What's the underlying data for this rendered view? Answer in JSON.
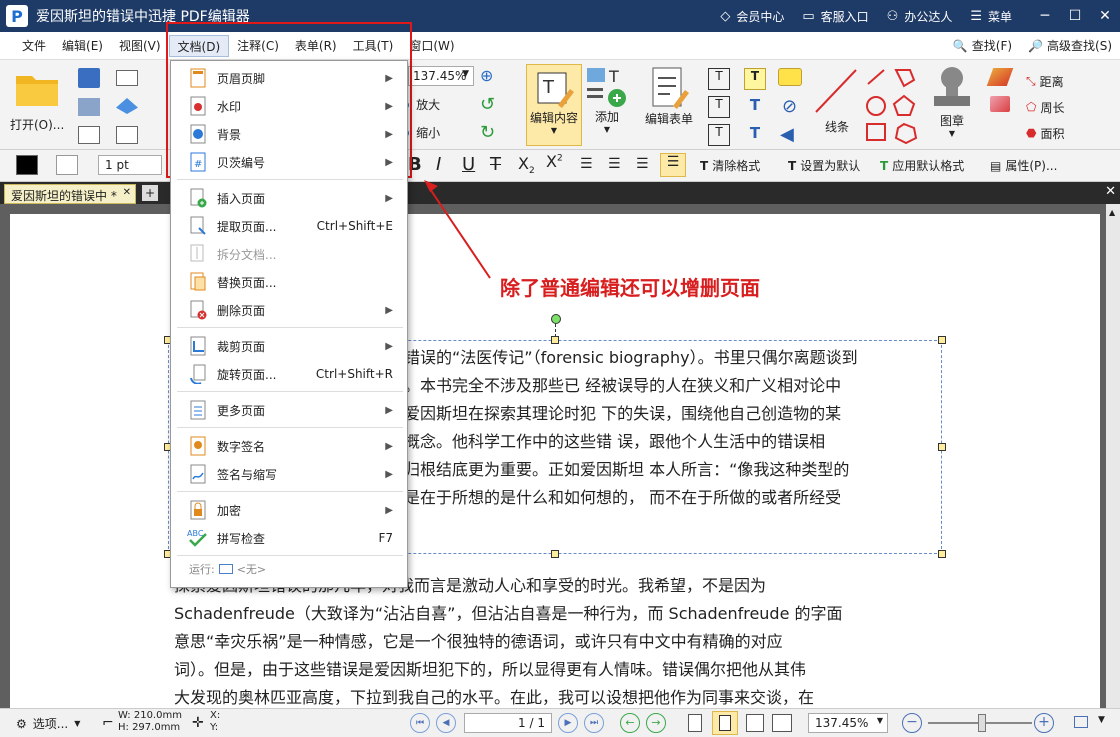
{
  "window": {
    "title": "爱因斯坦的错误中迅捷 PDF编辑器",
    "logo": "P",
    "member": "会员中心",
    "service": "客服入口",
    "user": "办公达人",
    "menu": "菜单"
  },
  "menubar": {
    "items": [
      "文件",
      "编辑(E)",
      "视图(V)",
      "文档(D)",
      "注释(C)",
      "表单(R)",
      "工具(T)",
      "窗口(W)"
    ],
    "find": "查找(F)",
    "adv_find": "高级查找(S)"
  },
  "ribbon": {
    "open": "打开(O)...",
    "zoom": "137.45%",
    "zoom_in": "放大",
    "zoom_out": "缩小",
    "edit_content": "编辑内容",
    "add": "添加",
    "edit_form": "编辑表单",
    "line": "线条",
    "stamp": "图章",
    "distance": "距离",
    "perimeter": "周长",
    "area": "面积"
  },
  "format": {
    "line_width": "1 pt",
    "clear_format": "清除格式",
    "set_default": "设置为默认",
    "apply_default": "应用默认格式",
    "props": "属性(P)..."
  },
  "tab": {
    "title": "爱因斯坦的错误中 *"
  },
  "dropdown": {
    "header_footer": "页眉页脚",
    "watermark": "水印",
    "background": "背景",
    "bates": "贝茨编号",
    "insert": "插入页面",
    "extract": "提取页面...",
    "extract_sc": "Ctrl+Shift+E",
    "split": "拆分文档...",
    "replace": "替换页面...",
    "delete": "删除页面",
    "crop": "裁剪页面",
    "rotate": "旋转页面...",
    "rotate_sc": "Ctrl+Shift+R",
    "more": "更多页面",
    "sign": "数字签名",
    "signinit": "签名与缩写",
    "encrypt": "加密",
    "spell": "拼写检查",
    "spell_sc": "F7",
    "run": "运行:",
    "run_val": "<无>"
  },
  "annotation": "除了普通编辑还可以增删页面",
  "doc": {
    "box": [
      "错误的“法医传记”（forensic biography）。书里只偶尔离题谈到",
      "。本书完全不涉及那些已   经被误导的人在狭义和广义相对论中",
      "爱因斯坦在探索其理论时犯     下的失误，围绕他自己创造物的某",
      "概念。他科学工作中的这些错       误，跟他个人生活中的错误相",
      "归根结底更为重要。正如爱因斯坦  本人所言：“像我这种类型的",
      "是在于所想的是什么和如何想的，  而不在于所做的或者所经受"
    ],
    "body": [
      "探索爱因斯坦错误的那几年，对我而言是激动人心和享受的时光。我希望，不是因为",
      "Schadenfreude（大致译为“沾沾自喜”，但沾沾自喜是一种行为，而 Schadenfreude 的字面",
      "意思“幸灾乐祸”是一种情感，它是一个很独特的德语词，或许只有中文中有精确的对应",
      "词）。但是，由于这些错误是爱因斯坦犯下的，所以显得更有人情味。错误偶尔把他从其伟",
      "大发现的奥林匹亚高度，下拉到我自己的水平。在此，我可以设想把他作为同事来交谈，在"
    ]
  },
  "status": {
    "options": "选项...",
    "w": "W: 210.0mm",
    "h": "H: 297.0mm",
    "x": "X:",
    "y": "Y:",
    "page": "1 / 1",
    "zoom": "137.45%"
  }
}
